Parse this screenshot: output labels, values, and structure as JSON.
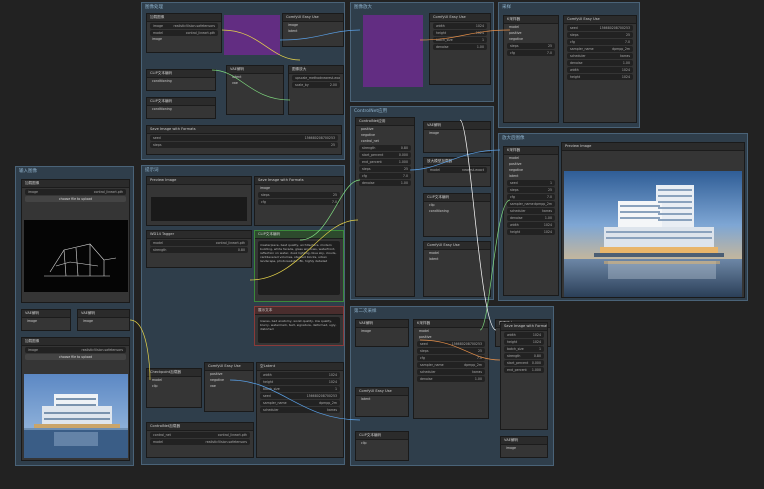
{
  "groups": {
    "top_left": "图像处理",
    "top_mid": "图像放大",
    "top_right": "采样",
    "left_col": "输入图像",
    "center": "提示词",
    "mid_right": "ControlNet应用",
    "right_big": "放大后图像",
    "bottom_mid": "第二次采样"
  },
  "nodes": {
    "save_image_title": "Save Image with Formats",
    "preview_title": "Preview Image",
    "load_image_title": "加载图像",
    "choose_file": "choose file to upload",
    "wd14_title": "WD14 Tagger",
    "clip_text_title": "CLIP文本编码",
    "ksampler_title": "K采样器",
    "vae_decode_title": "VAE解码",
    "controlnet_title": "ControlNet应用",
    "checkpoint_title": "Checkpoint加载器",
    "upscale_title": "图像放大",
    "easy_use": "ComfyUI Easy Use",
    "upscale_model": "放大模型加载器",
    "empty_latent": "空Latent",
    "show_text": "展示文本",
    "controlnet_loader": "ControlNet加载器"
  },
  "prompt_text": "masterpiece, best quality, architecture, modern building, white facade, glass windows, waterfront, reflection on water, dusk lighting, blue sky, clouds, cantilevered volumes, stacked blocks, urban landscape, photorealistic, 8k, highly detailed",
  "negative_text": "lowres, bad anatomy, worst quality, low quality, blurry, watermark, text, signature, deformed, ugly, distorted",
  "widgets": {
    "seed": "seed",
    "steps": "steps",
    "cfg": "cfg",
    "sampler": "sampler_name",
    "scheduler": "scheduler",
    "denoise": "denoise",
    "width": "width",
    "height": "height",
    "batch": "batch_size",
    "strength": "strength",
    "start": "start_percent",
    "end": "end_percent",
    "model": "model",
    "clip": "clip",
    "vae": "vae",
    "image": "image",
    "latent": "latent",
    "positive": "positive",
    "negative": "negative",
    "conditioning": "conditioning",
    "control_net": "control_net",
    "upscale_method": "upscale_method",
    "scale_by": "scale_by"
  },
  "values": {
    "seed": "156680208700253",
    "steps": "25",
    "cfg": "7.0",
    "sampler": "dpmpp_2m",
    "scheduler": "karras",
    "denoise": "1.00",
    "width": "1024",
    "height": "1024",
    "batch": "1",
    "strength": "0.80",
    "start": "0.000",
    "end": "1.000",
    "upscale_method": "nearest-exact",
    "scale_by": "2.00",
    "ckpt": "realisticVision.safetensors",
    "control_model": "control_lineart.pth"
  },
  "colors": {
    "group_bg": "#2f3e4b",
    "node_bg": "#353535",
    "accent_purple": "#6b2a8c",
    "wire_green": "#7fd97f",
    "wire_yellow": "#e6d44a",
    "wire_blue": "#5aa0e6",
    "wire_orange": "#e6904a"
  }
}
